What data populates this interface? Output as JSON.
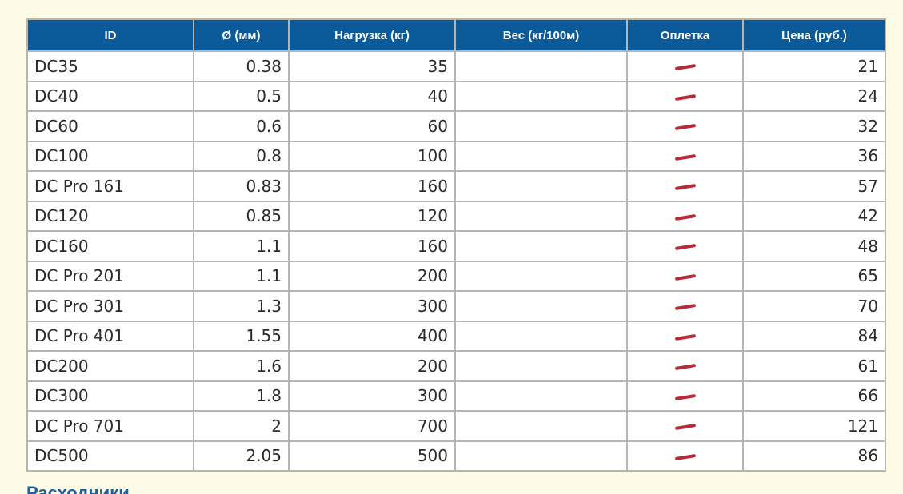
{
  "table": {
    "headers": {
      "id": "ID",
      "diameter": "Ø (мм)",
      "load": "Нагрузка (кг)",
      "weight": "Вес (кг/100м)",
      "braid": "Оплетка",
      "price": "Цена (руб.)"
    },
    "braid_icon": "red-dash-icon",
    "colors": {
      "header_bg": "#0b5a9a",
      "braid_mark": "#b62a39",
      "page_bg": "#fdfbe6"
    },
    "rows": [
      {
        "id": "DC35",
        "diameter": "0.38",
        "load": "35",
        "weight": "",
        "price": "21"
      },
      {
        "id": "DC40",
        "diameter": "0.5",
        "load": "40",
        "weight": "",
        "price": "24"
      },
      {
        "id": "DC60",
        "diameter": "0.6",
        "load": "60",
        "weight": "",
        "price": "32"
      },
      {
        "id": "DC100",
        "diameter": "0.8",
        "load": "100",
        "weight": "",
        "price": "36"
      },
      {
        "id": "DC Pro 161",
        "diameter": "0.83",
        "load": "160",
        "weight": "",
        "price": "57"
      },
      {
        "id": "DC120",
        "diameter": "0.85",
        "load": "120",
        "weight": "",
        "price": "42"
      },
      {
        "id": "DC160",
        "diameter": "1.1",
        "load": "160",
        "weight": "",
        "price": "48"
      },
      {
        "id": "DC Pro 201",
        "diameter": "1.1",
        "load": "200",
        "weight": "",
        "price": "65"
      },
      {
        "id": "DC Pro 301",
        "diameter": "1.3",
        "load": "300",
        "weight": "",
        "price": "70"
      },
      {
        "id": "DC Pro 401",
        "diameter": "1.55",
        "load": "400",
        "weight": "",
        "price": "84"
      },
      {
        "id": "DC200",
        "diameter": "1.6",
        "load": "200",
        "weight": "",
        "price": "61"
      },
      {
        "id": "DC300",
        "diameter": "1.8",
        "load": "300",
        "weight": "",
        "price": "66"
      },
      {
        "id": "DC Pro 701",
        "diameter": "2",
        "load": "700",
        "weight": "",
        "price": "121"
      },
      {
        "id": "DC500",
        "diameter": "2.05",
        "load": "500",
        "weight": "",
        "price": "86"
      }
    ]
  },
  "footer": {
    "heading": "Расходники"
  }
}
